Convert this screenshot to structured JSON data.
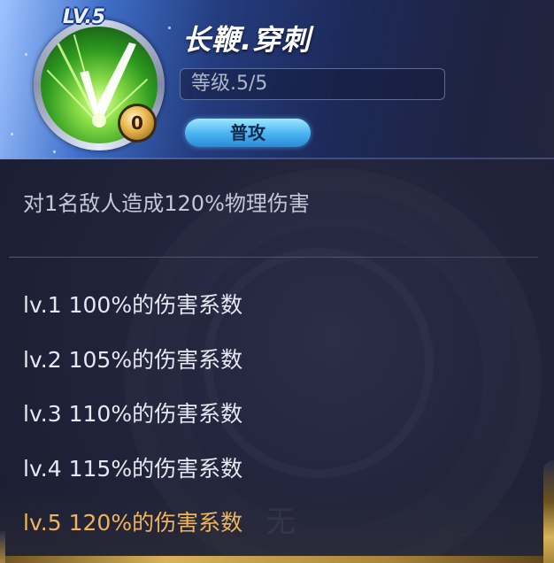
{
  "skill": {
    "level_badge": "LV.5",
    "name": "长鞭.穿刺",
    "level_text": "等级.5/5",
    "type_label": "普攻",
    "cost": "0",
    "icon": "green-whip-strike-icon"
  },
  "description": "对1名敌人造成120%物理伤害",
  "levels": [
    {
      "text": "lv.1 100%的伤害系数",
      "active": false
    },
    {
      "text": "lv.2 105%的伤害系数",
      "active": false
    },
    {
      "text": "lv.3 110%的伤害系数",
      "active": false
    },
    {
      "text": "lv.4 115%的伤害系数",
      "active": false
    },
    {
      "text": "lv.5 120%的伤害系数",
      "active": true
    }
  ],
  "colors": {
    "panel_bg": "#20233a",
    "active_level": "#f0b55a",
    "normal_text": "#e6e8f0",
    "type_pill": "#4eb7f2"
  }
}
